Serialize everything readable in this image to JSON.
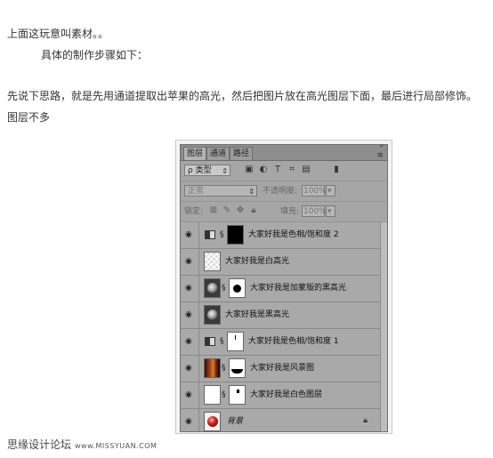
{
  "article": {
    "line1": "上面这玩意叫素材。。",
    "line2": "具体的制作步骤如下：",
    "line3": "先说下思路，就是先用通道提取出苹果的高光，然后把图片放在高光图层下面，最后进行局部修饰。",
    "line4": "图层不多"
  },
  "panel": {
    "tabs": [
      "图层",
      "通道",
      "路径"
    ],
    "filter_label": "ρ 类型",
    "blend_mode": "正常",
    "opacity_label": "不透明度:",
    "opacity_value": "100%",
    "lock_label": "锁定:",
    "fill_label": "填充:",
    "fill_value": "100%",
    "layers": [
      {
        "name": "大家好我是色相/饱和度 2"
      },
      {
        "name": "大家好我是白高光"
      },
      {
        "name": "大家好我是加蒙版的黑高光"
      },
      {
        "name": "大家好我是黑高光"
      },
      {
        "name": "大家好我是色相/饱和度 1"
      },
      {
        "name": "大家好我是风景图"
      },
      {
        "name": "大家好我是白色图层"
      },
      {
        "name": "背景"
      }
    ]
  },
  "footer": {
    "brand": "思缘设计论坛",
    "site": "www.MISSYUAN.COM"
  }
}
